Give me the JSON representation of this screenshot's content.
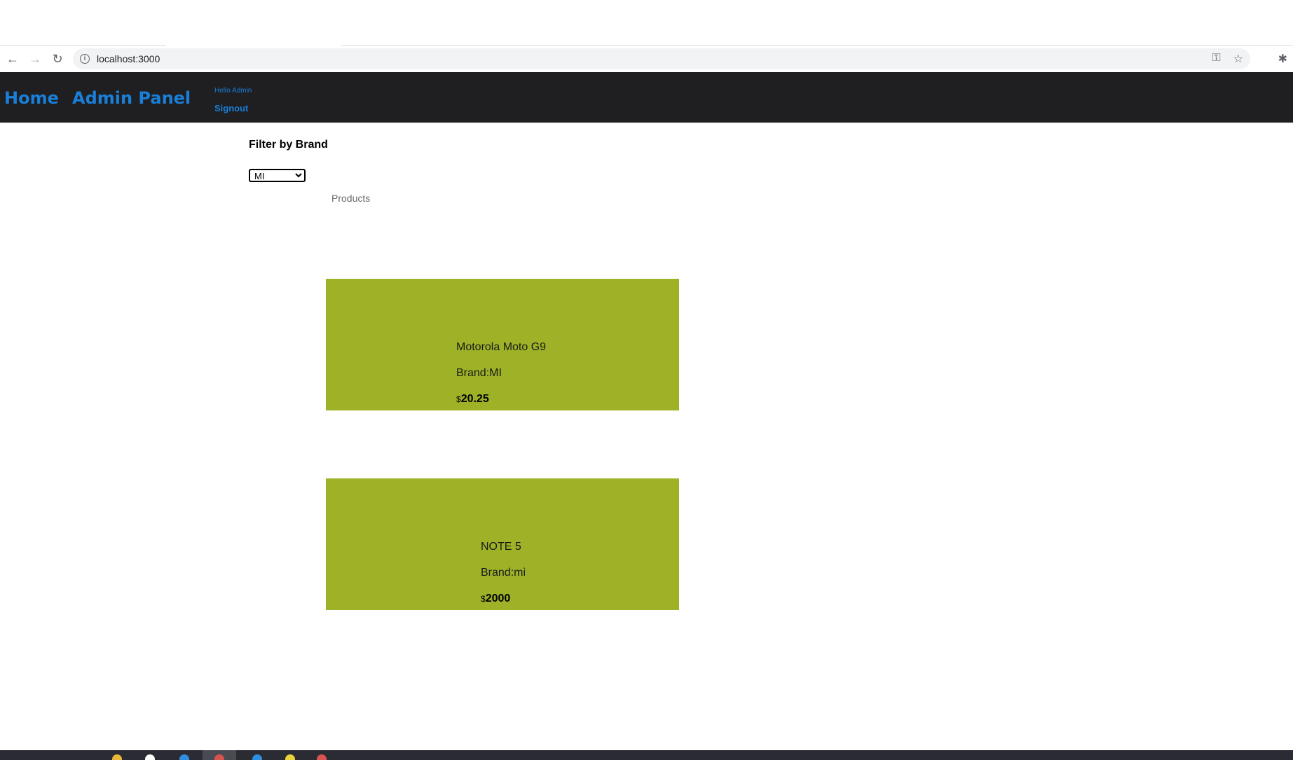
{
  "browser": {
    "url": "localhost:3000"
  },
  "navbar": {
    "home_label": "Home",
    "admin_label": "Admin Panel",
    "greeting": "Hello Admin",
    "signout_label": "Signout"
  },
  "filter": {
    "title": "Filter by Brand",
    "selected_brand": "MI",
    "options": [
      "MI"
    ]
  },
  "products": {
    "heading": "Products",
    "items": [
      {
        "name": "Motorola Moto G9",
        "brand_label": "Brand:MI",
        "currency": "$",
        "price": "20.25"
      },
      {
        "name": "NOTE 5",
        "brand_label": "Brand:mi",
        "currency": "$",
        "price": "2000"
      }
    ]
  },
  "colors": {
    "navbar_bg": "#1f1e21",
    "link_blue": "#1a7fd8",
    "card_bg": "#9fb227"
  }
}
